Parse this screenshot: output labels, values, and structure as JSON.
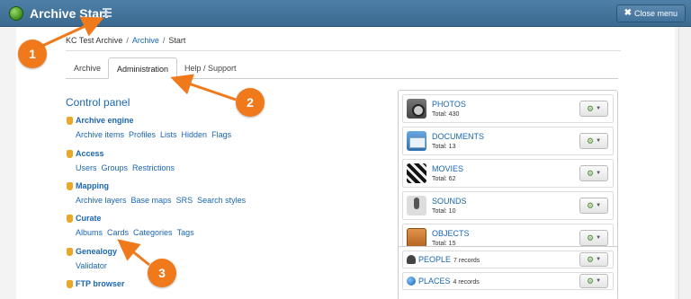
{
  "app": {
    "title": "Archive Start",
    "close_menu": "Close menu"
  },
  "breadcrumb": {
    "root": "KC Test Archive",
    "archive": "Archive",
    "current": "Start"
  },
  "tabs": [
    {
      "label": "Archive"
    },
    {
      "label": "Administration"
    },
    {
      "label": "Help / Support"
    }
  ],
  "control_panel": {
    "title": "Control panel",
    "sections": [
      {
        "title": "Archive engine",
        "links": [
          "Archive items",
          "Profiles",
          "Lists",
          "Hidden",
          "Flags"
        ]
      },
      {
        "title": "Access",
        "links": [
          "Users",
          "Groups",
          "Restrictions"
        ]
      },
      {
        "title": "Mapping",
        "links": [
          "Archive layers",
          "Base maps",
          "SRS",
          "Search styles"
        ]
      },
      {
        "title": "Curate",
        "links": [
          "Albums",
          "Cards",
          "Categories",
          "Tags"
        ]
      },
      {
        "title": "Genealogy",
        "links": [
          "Validator"
        ]
      },
      {
        "title": "FTP browser",
        "links": []
      }
    ]
  },
  "media": [
    {
      "name": "PHOTOS",
      "total": "Total: 430",
      "icon": "camera-icon"
    },
    {
      "name": "DOCUMENTS",
      "total": "Total: 13",
      "icon": "mail-icon"
    },
    {
      "name": "MOVIES",
      "total": "Total: 62",
      "icon": "clapperboard-icon"
    },
    {
      "name": "SOUNDS",
      "total": "Total: 10",
      "icon": "microphone-icon"
    },
    {
      "name": "OBJECTS",
      "total": "Total: 15",
      "icon": "box-icon"
    }
  ],
  "records": [
    {
      "name": "PEOPLE",
      "count": "7 records",
      "icon": "person-icon"
    },
    {
      "name": "PLACES",
      "count": "4 records",
      "icon": "globe-icon"
    }
  ],
  "callouts": [
    "1",
    "2",
    "3"
  ],
  "colors": {
    "topbar": "#4e7fa6",
    "link": "#1a66b0",
    "callout": "#f07a1b",
    "gear": "#4a8a2a"
  }
}
